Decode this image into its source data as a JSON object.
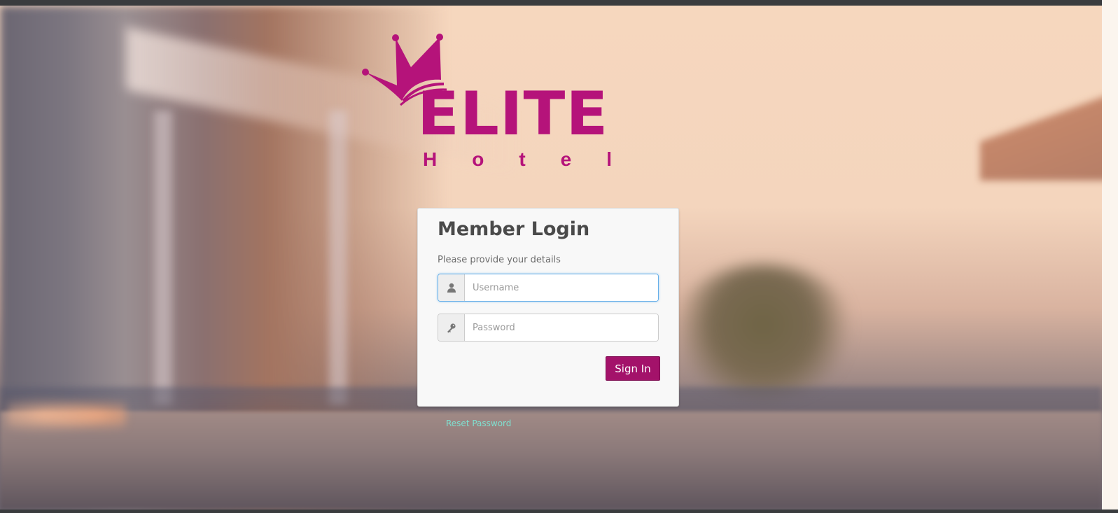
{
  "brand": {
    "name": "ELITE",
    "tagline_letters": [
      "H",
      "o",
      "t",
      "e",
      "l"
    ],
    "color": "#b5137a"
  },
  "login": {
    "title": "Member Login",
    "subtitle": "Please provide your details",
    "username": {
      "placeholder": "Username",
      "value": "",
      "icon": "user-icon"
    },
    "password": {
      "placeholder": "Password",
      "value": "",
      "icon": "key-icon"
    },
    "submit_label": "Sign In",
    "button_color": "#a3126a"
  },
  "links": {
    "reset_password": "Reset Password",
    "link_color": "#7fe0d0"
  }
}
